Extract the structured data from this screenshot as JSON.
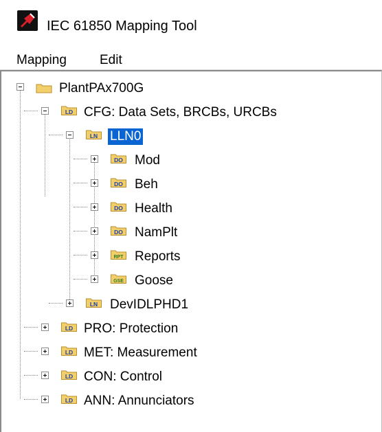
{
  "window": {
    "title": "IEC 61850 Mapping Tool"
  },
  "menu": {
    "items": [
      "Mapping",
      "Edit"
    ]
  },
  "tree": {
    "root": {
      "label": "PlantPAx700G",
      "expanded": true
    },
    "ld_cfg": {
      "tag": "LD",
      "label": "CFG: Data Sets, BRCBs, URCBs",
      "expanded": true
    },
    "ln_lln0": {
      "tag": "LN",
      "label": "LLN0",
      "expanded": true,
      "selected": true
    },
    "do_mod": {
      "tag": "DO",
      "label": "Mod"
    },
    "do_beh": {
      "tag": "DO",
      "label": "Beh"
    },
    "do_health": {
      "tag": "DO",
      "label": "Health"
    },
    "do_namplt": {
      "tag": "DO",
      "label": "NamPlt"
    },
    "rpt_reports": {
      "tag": "RPT",
      "label": "Reports"
    },
    "gse_goose": {
      "tag": "GSE",
      "label": "Goose"
    },
    "ln_devid": {
      "tag": "LN",
      "label": "DevIDLPHD1"
    },
    "ld_pro": {
      "tag": "LD",
      "label": "PRO: Protection"
    },
    "ld_met": {
      "tag": "LD",
      "label": "MET: Measurement"
    },
    "ld_con": {
      "tag": "LD",
      "label": "CON: Control"
    },
    "ld_ann": {
      "tag": "LD",
      "label": "ANN: Annunciators"
    }
  },
  "colors": {
    "folder": "#f2cf6a",
    "folder_dark": "#b8902f",
    "badge_text": "#1f3fa8",
    "rpt_badge": "#2b7a1e",
    "selection": "#0a64d2"
  }
}
